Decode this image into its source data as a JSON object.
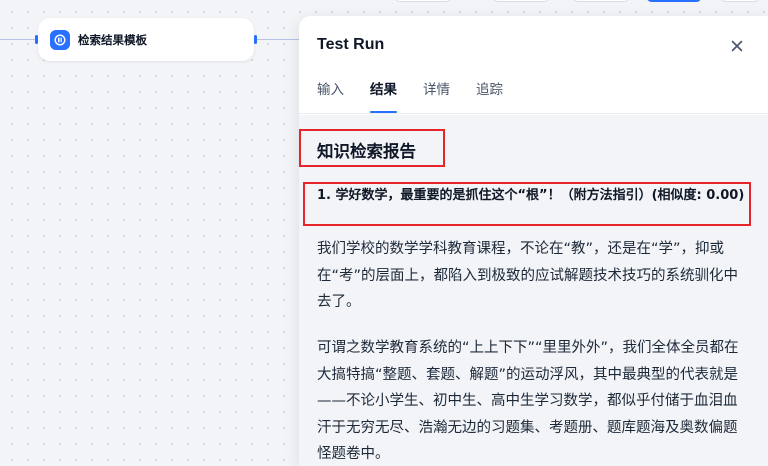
{
  "workflow_node": {
    "title": "检索结果模板",
    "icon": "document-icon",
    "icon_color": "#2970ff"
  },
  "panel": {
    "title": "Test Run",
    "close_icon": "close-icon",
    "tabs": [
      {
        "label": "输入",
        "active": false
      },
      {
        "label": "结果",
        "active": true
      },
      {
        "label": "详情",
        "active": false
      },
      {
        "label": "追踪",
        "active": false
      }
    ]
  },
  "result": {
    "heading": "知识检索报告",
    "item_title": "1. 学好数学，最重要的是抓住这个“根”！（附方法指引）(相似度: 0.00)",
    "paragraphs": [
      "我们学校的数学学科教育课程，不论在“教”，还是在“学”，抑或在“考”的层面上，都陷入到极致的应试解题技术技巧的系统驯化中去了。",
      "可谓之数学教育系统的“上上下下”“里里外外”，我们全体全员都在大搞特搞“整题、套题、解题”的运动浮风，其中最典型的代表就是——不论小学生、初中生、高中生学习数学，都似乎付储于血泪血汗于无穷无尽、浩瀚无边的习题集、考题册、题库题海及奥数偏题怪题卷中。"
    ]
  },
  "colors": {
    "accent": "#2970ff",
    "highlight_border": "#e5252a"
  }
}
